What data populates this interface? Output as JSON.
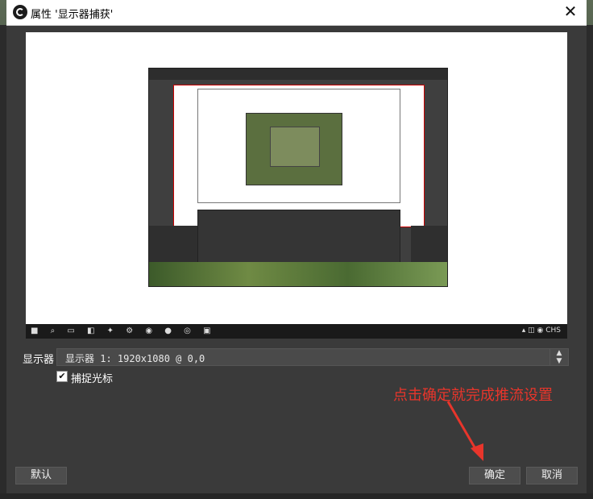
{
  "window": {
    "title": "属性 '显示器捕获'",
    "app_icon": "obs-logo-icon",
    "close_glyph": "✕"
  },
  "preview": {
    "taskbar_icons": "■ ⌕ ▭ ◧ ✦ ⚙ ◉ ● ◎ ▣",
    "tray_text": "▴ ◫ ◉ CHS"
  },
  "settings": {
    "display_label": "显示器",
    "display_value": "显示器 1: 1920x1080 @ 0,0",
    "capture_cursor_label": "捕捉光标",
    "capture_cursor_checked": true,
    "check_glyph": "✔"
  },
  "annotation": {
    "text": "点击确定就完成推流设置",
    "color": "#e8352b"
  },
  "buttons": {
    "default_label": "默认",
    "ok_label": "确定",
    "cancel_label": "取消"
  }
}
